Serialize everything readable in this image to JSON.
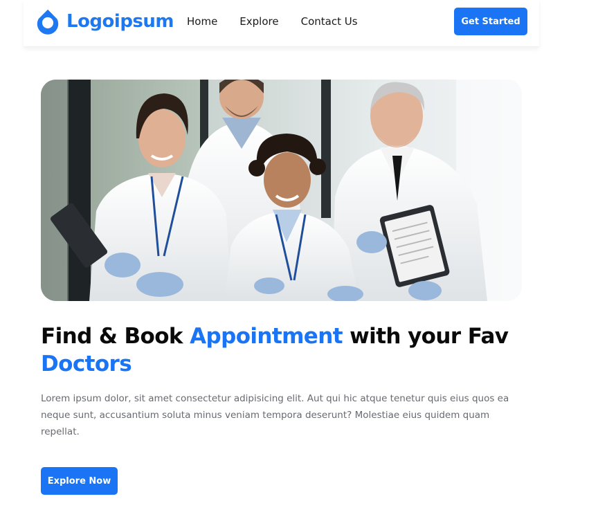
{
  "header": {
    "logo_text": "Logoipsum",
    "logo_icon": "drop-logo-icon",
    "nav": [
      {
        "label": "Home"
      },
      {
        "label": "Explore"
      },
      {
        "label": "Contact Us"
      }
    ],
    "cta_label": "Get Started"
  },
  "hero": {
    "image": "doctors-team-photo",
    "title_part1": "Find & Book ",
    "title_highlight1": "Appointment",
    "title_part2": " with your Fav ",
    "title_highlight2": "Doctors",
    "description": "Lorem ipsum dolor, sit amet consectetur adipisicing elit. Aut qui hic atque tenetur quis eius quos ea neque sunt, accusantium soluta minus veniam tempora deserunt? Molestiae eius quidem quam repellat.",
    "cta_label": "Explore Now"
  },
  "colors": {
    "brand": "#1a74f4",
    "logo": "#1e78f0",
    "text_dark": "#0a0a0a",
    "text_muted": "#666a70"
  }
}
